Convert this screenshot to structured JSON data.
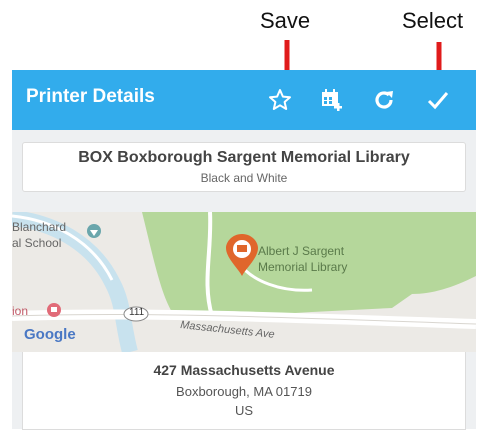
{
  "annotations": {
    "save_label": "Save",
    "select_label": "Select",
    "arrow_color": "#e01b1b"
  },
  "appbar": {
    "title": "Printer Details",
    "color": "#32acec",
    "icons": [
      "star-outline-icon",
      "calendar-add-icon",
      "refresh-icon",
      "check-icon"
    ]
  },
  "printer": {
    "name": "BOX Boxborough Sargent Memorial Library",
    "type": "Black and White"
  },
  "map": {
    "poi_labels": [
      "Blanchard",
      "al School",
      "Albert J Sargent",
      "Memorial Library",
      "ion"
    ],
    "road_number": "111",
    "road_name": "Massachusetts Ave",
    "attribution": "Google"
  },
  "address": {
    "line1": "427 Massachusetts Avenue",
    "line2": "Boxborough, MA 01719",
    "line3": "US"
  }
}
